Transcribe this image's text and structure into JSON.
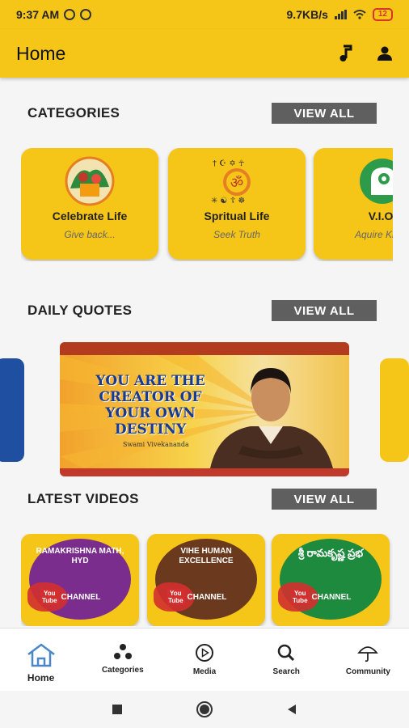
{
  "status_bar": {
    "time": "9:37 AM",
    "net_speed": "9.7KB/s",
    "battery": "12"
  },
  "app_bar": {
    "title": "Home",
    "music_icon": "music-note-icon",
    "profile_icon": "person-icon"
  },
  "categories": {
    "title": "CATEGORIES",
    "view_all": "VIEW ALL",
    "items": [
      {
        "name": "Celebrate Life",
        "subtitle": "Give back...",
        "icon": "celebration-image"
      },
      {
        "name": "Spritual Life",
        "subtitle": "Seek Truth",
        "icon": "om-symbol-image"
      },
      {
        "name": "V.I.O.",
        "subtitle": "Aquire Know",
        "icon": "head-gear-image"
      }
    ]
  },
  "daily_quotes": {
    "title": "DAILY QUOTES",
    "view_all": "VIEW ALL",
    "quote_line1": "YOU ARE THE",
    "quote_line2": "CREATOR OF",
    "quote_line3": "YOUR OWN",
    "quote_line4": "DESTINY",
    "author": "Swami Vivekananda"
  },
  "latest_videos": {
    "title": "LATEST VIDEOS",
    "view_all": "VIEW ALL",
    "items": [
      {
        "title": "RAMAKRISHNA MATH, HYD",
        "yt_top": "You",
        "yt_bottom": "Tube",
        "channel": "CHANNEL",
        "color": "#7b2d8e"
      },
      {
        "title": "VIHE HUMAN EXCELLENCE",
        "yt_top": "You",
        "yt_bottom": "Tube",
        "channel": "CHANNEL",
        "color": "#6b3a1e"
      },
      {
        "title": "శ్రీ రామకృష్ణ ప్రభ",
        "yt_top": "You",
        "yt_bottom": "Tube",
        "channel": "CHANNEL",
        "color": "#1e8a3e"
      }
    ]
  },
  "bottom_nav": [
    {
      "label": "Home",
      "icon": "home-icon",
      "active": true
    },
    {
      "label": "Categories",
      "icon": "categories-icon",
      "active": false
    },
    {
      "label": "Media",
      "icon": "play-circle-icon",
      "active": false
    },
    {
      "label": "Search",
      "icon": "search-icon",
      "active": false
    },
    {
      "label": "Community",
      "icon": "umbrella-icon",
      "active": false
    }
  ],
  "colors": {
    "primary": "#f5c518",
    "button_gray": "#5f5f5f",
    "nav_active": "#4a86c8"
  }
}
